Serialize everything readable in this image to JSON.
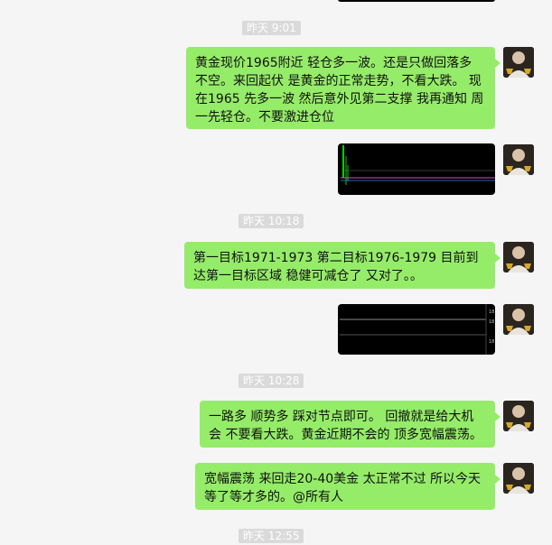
{
  "timestamps": [
    "昨天 9:01",
    "昨天 10:18",
    "昨天 10:28",
    "昨天 12:55"
  ],
  "messages": [
    "黄金现价1965附近 轻仓多一波。还是只做回落多 不空。来回起伏 是黄金的正常走势，不看大跌。 现在1965 先多一波 然后意外见第二支撑 我再通知  周一先轻仓。不要激进仓位",
    "第一目标1971-1973  第二目标1976-1979 目前到达第一目标区域  稳健可减仓了   又对了。。",
    "一路多 顺势多 踩对节点即可。 回撤就是给大机会 不要看大跌。黄金近期不会的 顶多宽幅震荡。",
    "宽幅震荡 来回走20-40美金 太正常不过    所以今天等了等才多的。@所有人"
  ],
  "chart2_axis_labels": [
    "18",
    "18",
    "18"
  ],
  "colors": {
    "bubble": "#95ec69",
    "background": "#f5f5f5",
    "timestamp_bg": "#dadada"
  }
}
